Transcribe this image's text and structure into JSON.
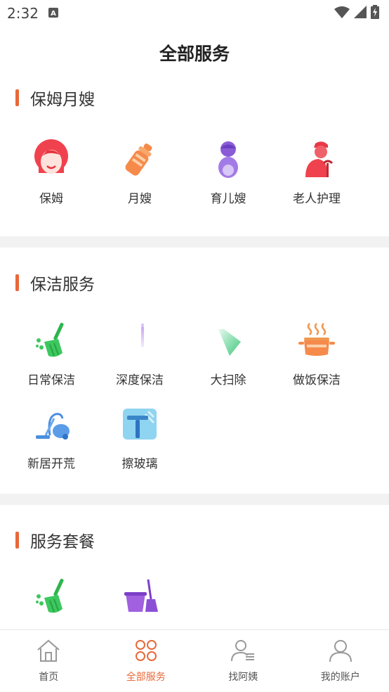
{
  "status": {
    "time": "2:32",
    "notif_icon": "a-notification-icon",
    "wifi_icon": "wifi-icon",
    "signal_icon": "signal-icon",
    "battery_icon": "battery-charging-icon"
  },
  "header": {
    "title": "全部服务"
  },
  "sections": [
    {
      "title": "保姆月嫂",
      "items": [
        {
          "label": "保姆",
          "icon": "nanny-icon"
        },
        {
          "label": "月嫂",
          "icon": "baby-bottle-icon"
        },
        {
          "label": "育儿嫂",
          "icon": "childcare-icon"
        },
        {
          "label": "老人护理",
          "icon": "elderly-care-icon"
        }
      ]
    },
    {
      "title": "保洁服务",
      "items": [
        {
          "label": "日常保洁",
          "icon": "broom-icon"
        },
        {
          "label": "深度保洁",
          "icon": "spray-icon"
        },
        {
          "label": "大扫除",
          "icon": "dustpan-icon"
        },
        {
          "label": "做饭保洁",
          "icon": "cooking-pot-icon"
        },
        {
          "label": "新居开荒",
          "icon": "vacuum-icon"
        },
        {
          "label": "擦玻璃",
          "icon": "window-wiper-icon"
        }
      ]
    },
    {
      "title": "服务套餐",
      "items": [
        {
          "label": "",
          "icon": "broom-icon"
        },
        {
          "label": "",
          "icon": "bucket-mop-icon"
        }
      ]
    }
  ],
  "tabs": [
    {
      "label": "首页",
      "icon": "home-icon",
      "active": false
    },
    {
      "label": "全部服务",
      "icon": "services-grid-icon",
      "active": true
    },
    {
      "label": "找阿姨",
      "icon": "find-person-icon",
      "active": false
    },
    {
      "label": "我的账户",
      "icon": "account-icon",
      "active": false
    }
  ],
  "colors": {
    "accent": "#e8693a",
    "divider": "#f2f2f2"
  }
}
